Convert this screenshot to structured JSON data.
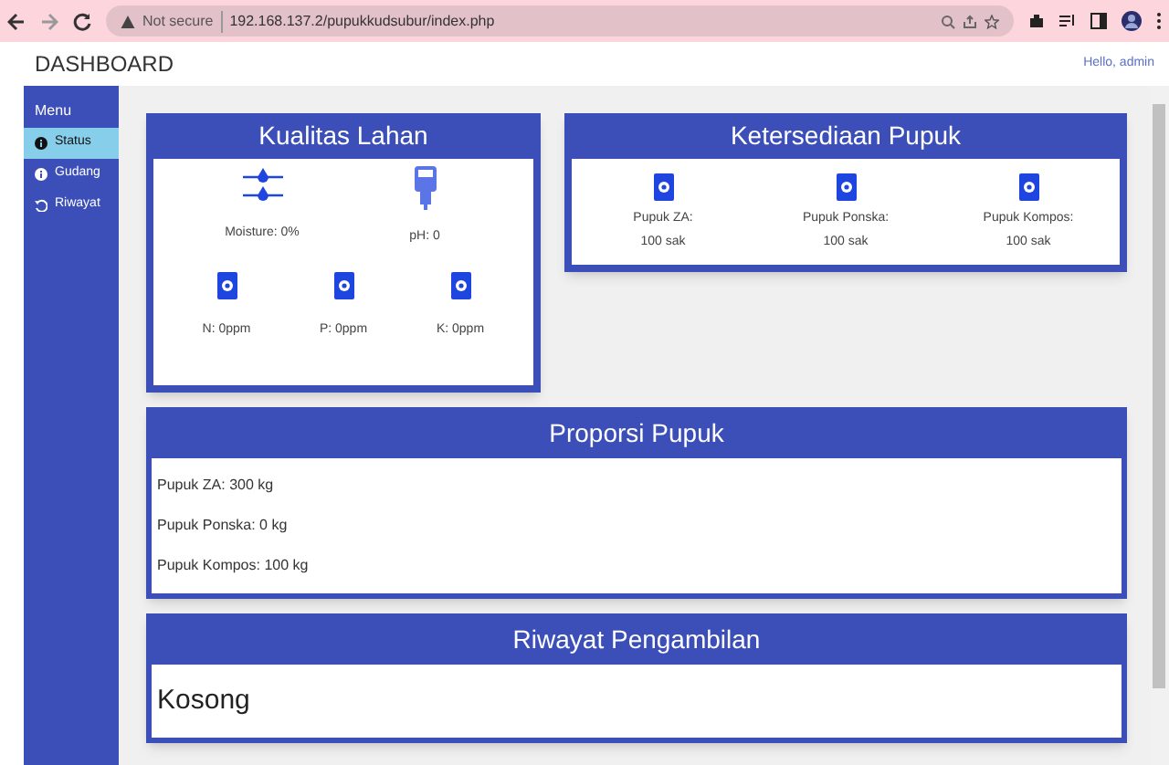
{
  "browser": {
    "security": "Not secure",
    "url": "192.168.137.2/pupukkudsubur/index.php"
  },
  "header": {
    "title": "DASHBOARD",
    "greeting": "Hello, admin"
  },
  "sidebar": {
    "heading": "Menu",
    "items": [
      {
        "label": "Status",
        "kind": "info",
        "selected": true
      },
      {
        "label": "Gudang",
        "kind": "info",
        "selected": false
      },
      {
        "label": "Riwayat",
        "kind": "history",
        "selected": false
      }
    ]
  },
  "kualitas_lahan": {
    "title": "Kualitas Lahan",
    "sensors": [
      {
        "label": "Moisture: 0%",
        "kind": "water"
      },
      {
        "label": "pH: 0",
        "kind": "meter"
      }
    ],
    "nutrients": [
      {
        "label": "N: 0ppm"
      },
      {
        "label": "P: 0ppm"
      },
      {
        "label": "K: 0ppm"
      }
    ]
  },
  "ketersediaan_pupuk": {
    "title": "Ketersediaan Pupuk",
    "items": [
      {
        "name": "Pupuk ZA:",
        "amount": "100 sak"
      },
      {
        "name": "Pupuk Ponska:",
        "amount": "100 sak"
      },
      {
        "name": "Pupuk Kompos:",
        "amount": "100 sak"
      }
    ]
  },
  "proporsi_pupuk": {
    "title": "Proporsi Pupuk",
    "lines": [
      "Pupuk ZA: 300 kg",
      "Pupuk Ponska: 0 kg",
      "Pupuk Kompos: 100 kg"
    ]
  },
  "riwayat_pengambilan": {
    "title": "Riwayat Pengambilan",
    "content": "Kosong"
  }
}
